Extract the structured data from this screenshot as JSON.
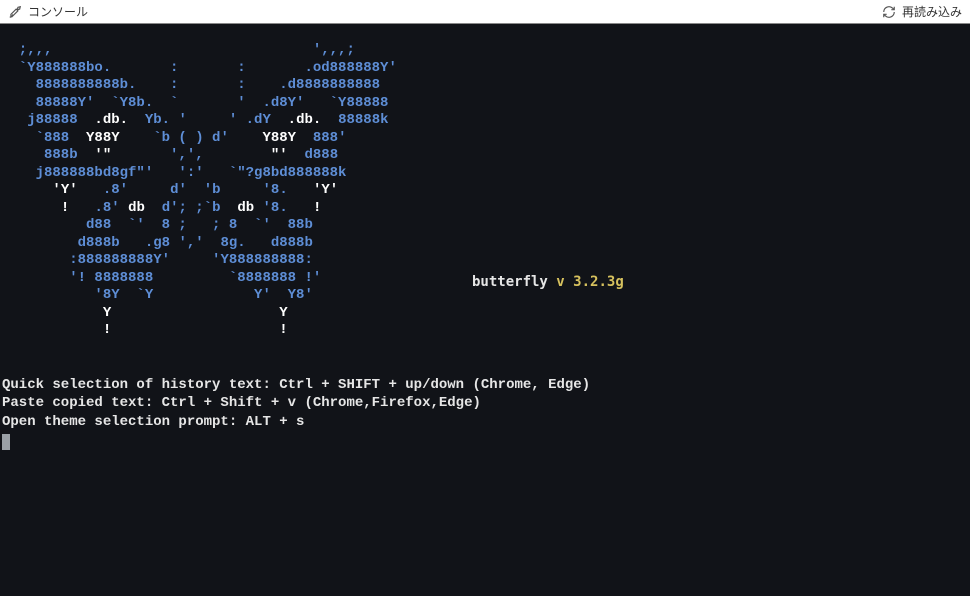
{
  "titlebar": {
    "title": "コンソール",
    "reload_label": "再読み込み"
  },
  "app": {
    "name": "butterfly",
    "separator": "v",
    "version": "3.2.3g"
  },
  "ascii_art": {
    "lines_html": [
      "<span class=\"b\">  ;,,,                               ',,,;</span>",
      "<span class=\"b\">  `Y888888bo.       :       :       .od888888Y'</span>",
      "<span class=\"b\">    8888888888b.    :       :    .d8888888888</span>",
      "<span class=\"b\">    88888Y'  `Y8b.  `       '  .d8Y'   `Y88888</span>",
      "<span class=\"b\">   j88888  </span><span class=\"w\">.db.</span><span class=\"b\">  Yb. '     ' .dY  </span><span class=\"w\">.db.</span><span class=\"b\">  88888k</span>",
      "<span class=\"b\">    `888  </span><span class=\"w\">Y88Y</span><span class=\"b\">    `b ( ) d'    </span><span class=\"w\">Y88Y</span><span class=\"b\">  888'</span>",
      "<span class=\"b\">     888b  </span><span class=\"w\">'\"</span><span class=\"b\">       ',',        </span><span class=\"w\">\"'</span><span class=\"b\">  d888</span>",
      "<span class=\"b\">    j888888bd8gf\"'   ':'   `\"?g8bd888888k</span>",
      "      <span class=\"w\">'Y'</span>   <span class=\"b\">.8'</span>     <span class=\"b\">d'  'b</span>     <span class=\"b\">'8.</span>   <span class=\"w\">'Y'</span>",
      "       <span class=\"w\">!</span>   <span class=\"b\">.8'</span> <span class=\"w\">db</span>  <span class=\"b\">d'; ;`b</span>  <span class=\"w\">db</span> <span class=\"b\">'8.</span>   <span class=\"w\">!</span>",
      "          <span class=\"b\">d88  `'  8 ;   ; 8  `'  88b</span>",
      "         <span class=\"b\">d888b   .g8 ','  8g.   d888b</span>",
      "        <span class=\"b\">:888888888Y'     'Y888888888:</span>",
      "        <span class=\"b\">'! 8888888         `8888888 !'</span>",
      "           <span class=\"b\">'8Y  `Y            Y'  Y8'</span>",
      "            <span class=\"w\">Y                    Y</span>",
      "            <span class=\"w\">!                    !</span>"
    ]
  },
  "help": {
    "lines": [
      "Quick selection of history text: Ctrl + SHIFT + up/down (Chrome, Edge)",
      "Paste copied text: Ctrl + Shift + v (Chrome,Firefox,Edge)",
      "Open theme selection prompt: ALT + s"
    ]
  },
  "colors": {
    "terminal_background": "#111318",
    "ascii_blue": "#5e8ed6",
    "ascii_yellow": "#d6c15e",
    "text": "#e6e6e6"
  }
}
